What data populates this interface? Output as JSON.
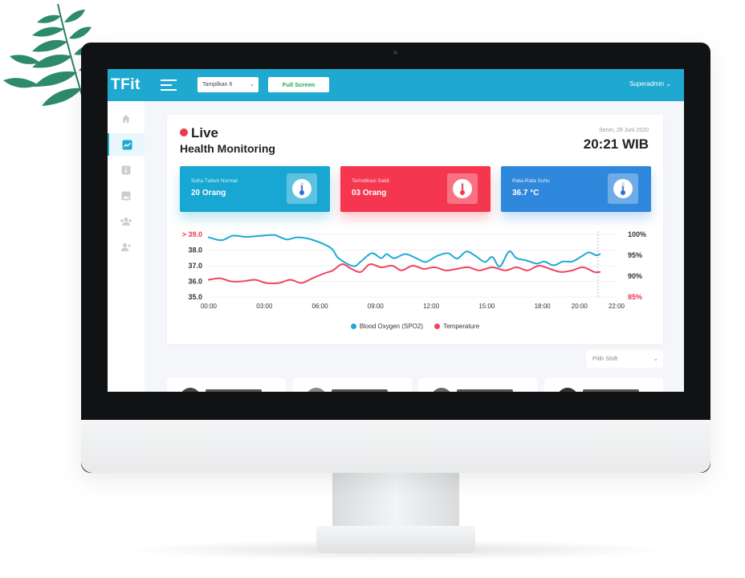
{
  "app": {
    "logo": "TFit",
    "user_menu": "Superadmin ⌄"
  },
  "topbar": {
    "select_value": "Tampilkan 6",
    "fullscreen_label": "Full Screen"
  },
  "sidebar": {
    "items": [
      {
        "icon": "home-icon"
      },
      {
        "icon": "chart-icon",
        "active": true
      },
      {
        "icon": "info-icon"
      },
      {
        "icon": "image-icon"
      },
      {
        "icon": "users-icon"
      },
      {
        "icon": "user-add-icon"
      }
    ]
  },
  "header": {
    "live": "Live",
    "title": "Health Monitoring",
    "date": "Senin, 29 Juni 2020",
    "time": "20:21 WIB"
  },
  "stats": [
    {
      "label": "Suhu Tubuh Normal",
      "value": "20 Orang",
      "color": "#17a7d2",
      "icon": "thermometer-icon"
    },
    {
      "label": "Terindikasi Sakit",
      "value": "03 Orang",
      "color": "#f5364f",
      "icon": "thermometer-icon"
    },
    {
      "label": "Rata-Rata Suhu",
      "value": "36.7 °C",
      "color": "#2f88dc",
      "icon": "thermometer-icon"
    }
  ],
  "chart_data": {
    "type": "line",
    "x_ticks": [
      "00:00",
      "03:00",
      "06:00",
      "09:00",
      "12:00",
      "15:00",
      "18:00",
      "20:00",
      "22:00"
    ],
    "y_left_ticks": [
      "> 39.0",
      "38.0",
      "37.0",
      "36.0",
      "35.0"
    ],
    "y_right_ticks": [
      "100%",
      "95%",
      "90%",
      "85%"
    ],
    "y_left_range": [
      35.0,
      39.0
    ],
    "y_right_range": [
      85,
      100
    ],
    "highlight_color": "#f0364f",
    "marker_x": 21.0,
    "series": [
      {
        "name": "Blood Oxygen (SPO2)",
        "axis": "right",
        "color": "#20a9d4",
        "points": [
          [
            0,
            99.3
          ],
          [
            0.7,
            98.6
          ],
          [
            1.3,
            99.7
          ],
          [
            2,
            99.4
          ],
          [
            2.6,
            99.6
          ],
          [
            3.2,
            99.8
          ],
          [
            3.6,
            99.8
          ],
          [
            4.2,
            98.8
          ],
          [
            4.8,
            99.3
          ],
          [
            5.6,
            98.7
          ],
          [
            6.6,
            96.7
          ],
          [
            7,
            94.3
          ],
          [
            7.8,
            92.4
          ],
          [
            8.2,
            93.5
          ],
          [
            8.8,
            95.5
          ],
          [
            9.3,
            94.3
          ],
          [
            9.6,
            95.3
          ],
          [
            10,
            94.3
          ],
          [
            10.6,
            95.3
          ],
          [
            11.2,
            94.3
          ],
          [
            11.7,
            93.4
          ],
          [
            12.3,
            94.8
          ],
          [
            12.9,
            95.5
          ],
          [
            13.4,
            94.2
          ],
          [
            13.9,
            95.9
          ],
          [
            14.4,
            94.8
          ],
          [
            14.9,
            93.4
          ],
          [
            15.3,
            94.6
          ],
          [
            15.7,
            92.3
          ],
          [
            16.2,
            95.9
          ],
          [
            16.6,
            94.3
          ],
          [
            17.1,
            93.8
          ],
          [
            17.7,
            93.0
          ],
          [
            18.1,
            93.5
          ],
          [
            18.6,
            92.6
          ],
          [
            19.1,
            93.5
          ],
          [
            19.6,
            93.5
          ],
          [
            20.1,
            94.7
          ],
          [
            20.5,
            95.7
          ],
          [
            20.9,
            95.0
          ],
          [
            21.1,
            95.3
          ]
        ]
      },
      {
        "name": "Temperature",
        "axis": "left",
        "color": "#f0445e",
        "points": [
          [
            0,
            36.1
          ],
          [
            0.6,
            36.2
          ],
          [
            1.2,
            36.0
          ],
          [
            1.8,
            36.0
          ],
          [
            2.5,
            36.1
          ],
          [
            3.1,
            35.9
          ],
          [
            3.8,
            35.9
          ],
          [
            4.4,
            36.1
          ],
          [
            5,
            35.9
          ],
          [
            5.6,
            36.2
          ],
          [
            6.2,
            36.5
          ],
          [
            6.7,
            36.7
          ],
          [
            7.2,
            37.1
          ],
          [
            7.7,
            36.8
          ],
          [
            8.2,
            36.6
          ],
          [
            8.7,
            37.1
          ],
          [
            9.3,
            36.9
          ],
          [
            9.9,
            37.0
          ],
          [
            10.4,
            36.7
          ],
          [
            11,
            37.0
          ],
          [
            11.6,
            36.8
          ],
          [
            12.2,
            36.9
          ],
          [
            12.8,
            36.7
          ],
          [
            13.4,
            36.8
          ],
          [
            14,
            36.9
          ],
          [
            14.6,
            36.7
          ],
          [
            15.3,
            36.9
          ],
          [
            16,
            36.7
          ],
          [
            16.6,
            36.9
          ],
          [
            17.2,
            36.7
          ],
          [
            17.8,
            37.0
          ],
          [
            18.4,
            36.8
          ],
          [
            19,
            36.6
          ],
          [
            19.6,
            36.7
          ],
          [
            20.2,
            36.9
          ],
          [
            20.8,
            36.6
          ],
          [
            21.1,
            36.6
          ]
        ]
      }
    ],
    "legend_position": "bottom-center"
  },
  "shift_select": {
    "value": "Pilih Shift"
  },
  "people_cards_count": 4
}
